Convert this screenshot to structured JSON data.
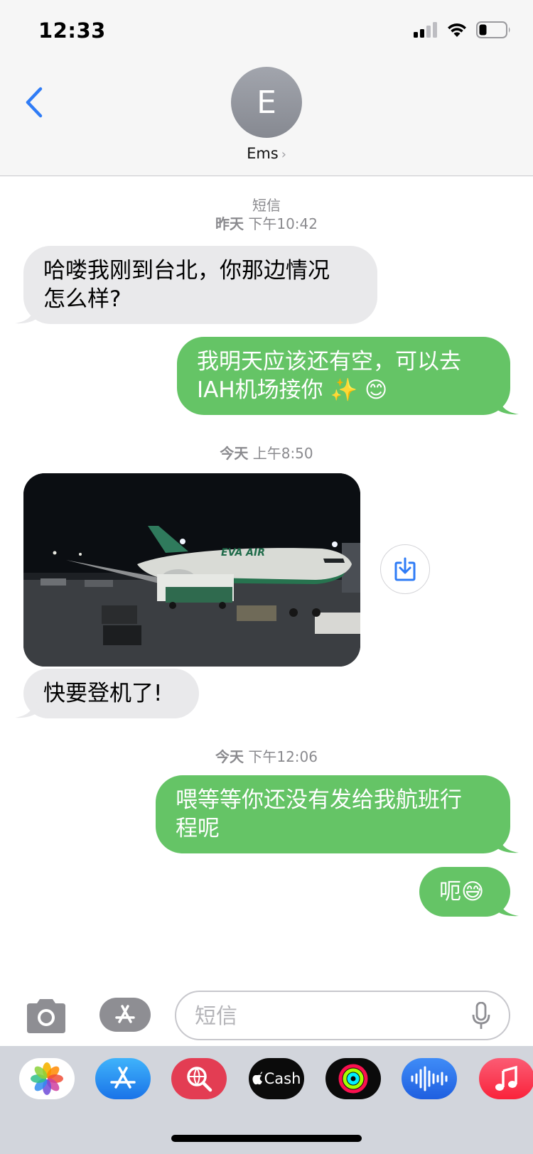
{
  "status_bar": {
    "time": "12:33"
  },
  "header": {
    "avatar_initial": "E",
    "contact_name": "Ems",
    "name_chevron": "›"
  },
  "conversation": {
    "timestamps": [
      {
        "service": "短信",
        "day": "昨天",
        "time": "下午10:42"
      },
      {
        "day": "今天",
        "time": "上午8:50"
      },
      {
        "day": "今天",
        "time": "下午12:06"
      }
    ],
    "messages": [
      {
        "direction": "incoming",
        "lines": [
          "哈喽我刚到台北，你那边情况",
          "怎么样?"
        ]
      },
      {
        "direction": "outgoing",
        "lines": [
          "我明天应该还有空，可以去",
          "IAH机场接你 ✨ 😊"
        ]
      },
      {
        "direction": "incoming",
        "type": "photo",
        "photo_text": "EVA AIR"
      },
      {
        "direction": "incoming",
        "lines": [
          "快要登机了!"
        ]
      },
      {
        "direction": "outgoing",
        "lines": [
          "喂等等你还没有发给我航班行",
          "程呢"
        ]
      },
      {
        "direction": "outgoing",
        "lines": [
          "呃😅"
        ]
      }
    ]
  },
  "input": {
    "placeholder": "短信"
  },
  "app_drawer": {
    "apps": [
      {
        "icon": "photos-icon"
      },
      {
        "icon": "app-store-icon"
      },
      {
        "icon": "web-search-icon"
      },
      {
        "icon": "apple-cash-icon",
        "label": "Cash"
      },
      {
        "icon": "activity-icon"
      },
      {
        "icon": "audio-message-icon"
      },
      {
        "icon": "music-icon"
      }
    ]
  },
  "colors": {
    "incoming_bubble": "#e9e9eb",
    "outgoing_bubble": "#65c466",
    "accent_blue": "#2f7cf6",
    "timestamp_gray": "#8a8a8e"
  }
}
